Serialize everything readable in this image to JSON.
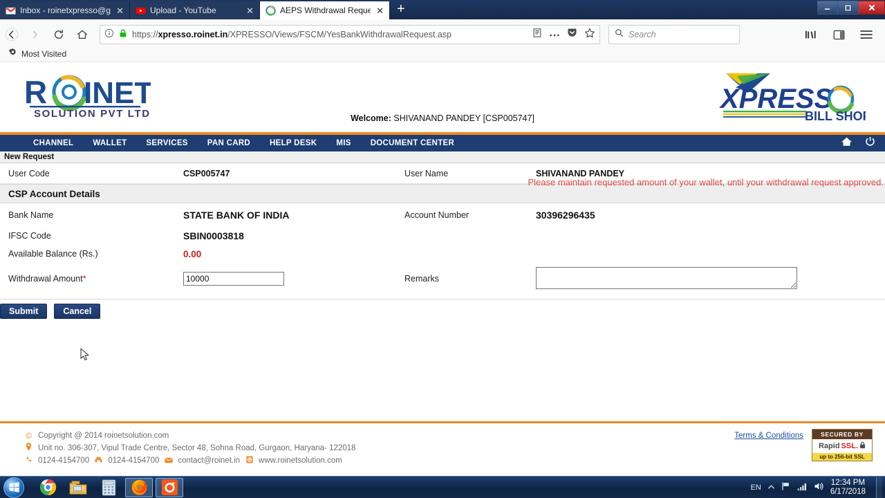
{
  "browser": {
    "tabs": [
      {
        "title": "Inbox - roinetxpresso@gmail.c",
        "favicon": "gmail-icon",
        "active": false,
        "close": "✕"
      },
      {
        "title": "Upload - YouTube",
        "favicon": "youtube-icon",
        "active": false,
        "close": "✕"
      },
      {
        "title": "AEPS Withdrawal Request",
        "favicon": "roinet-icon",
        "active": true,
        "close": "✕"
      }
    ],
    "new_tab_label": "+",
    "window_controls": {
      "minimize": "—",
      "maximize": "❐",
      "close": "✕"
    },
    "nav": {
      "back_icon": "back-arrow-icon",
      "forward_icon": "forward-arrow-icon",
      "reload_icon": "reload-icon",
      "home_icon": "home-icon",
      "info_icon": "page-info-icon",
      "lock_icon": "padlock-icon",
      "reader_icon": "reader-view-icon",
      "more_icon": "page-actions-icon",
      "pocket_icon": "pocket-icon",
      "star_icon": "bookmark-star-icon",
      "library_icon": "library-icon",
      "sidebar_icon": "sidebar-icon",
      "menu_icon": "hamburger-menu-icon"
    },
    "url": {
      "scheme": "https://",
      "host": "xpresso.roinet.in",
      "path": "/XPRESSO/Views/FSCM/YesBankWithdrawalRequest.asp",
      "truncated_tail": ""
    },
    "search": {
      "placeholder": "Search",
      "icon": "search-icon"
    },
    "bookmarks": [
      {
        "label": "Most Visited",
        "icon": "gear-icon"
      }
    ]
  },
  "site": {
    "logo_left": {
      "name": "ROINET",
      "tagline": "SOLUTION PVT LTD"
    },
    "logo_right": {
      "name": "XPRESSO",
      "tagline": "BILL SHOP"
    },
    "welcome_label": "Welcome:",
    "welcome_user": "SHIVANAND PANDEY [CSP005747]",
    "nav_items": [
      "CHANNEL",
      "WALLET",
      "SERVICES",
      "PAN CARD",
      "HELP DESK",
      "MIS",
      "DOCUMENT CENTER"
    ],
    "nav_icons": [
      "home-icon",
      "power-icon"
    ],
    "accent_orange": "#f08a24",
    "nav_blue": "#1d3d73"
  },
  "page": {
    "subbar_title": "New Request",
    "fields": {
      "user_code_label": "User Code",
      "user_code_value": "CSP005747",
      "user_name_label": "User Name",
      "user_name_value": "SHIVANAND PANDEY",
      "section_title": "CSP Account Details",
      "bank_name_label": "Bank Name",
      "bank_name_value": "STATE BANK OF INDIA",
      "account_number_label": "Account Number",
      "account_number_value": "30396296435",
      "ifsc_label": "IFSC Code",
      "ifsc_value": "SBIN0003818",
      "available_balance_label": "Available Balance (Rs.)",
      "available_balance_value": "0.00",
      "withdrawal_label": "Withdrawal Amount",
      "withdrawal_required_mark": "*",
      "withdrawal_value": "10000",
      "remarks_label": "Remarks",
      "remarks_value": ""
    },
    "buttons": {
      "submit": "Submit",
      "cancel": "Cancel"
    },
    "warning": "Please maintain requested amount of your wallet, until your withdrawal request approved.",
    "warning_color": "#e04545"
  },
  "footer": {
    "copyright": "Copyright @ 2014 roinetsolution.com",
    "copyright_icon": "copyright-icon",
    "address": "Unit no. 306-307, Vipul Trade Centre, Sector 48, Sohna Road, Gurgaon, Haryana- 122018",
    "address_icon": "location-pin-icon",
    "phone": "0124-4154700",
    "phone_icon": "phone-icon",
    "fax": "0124-4154700",
    "fax_icon": "fax-icon",
    "email": "contact@roinet.in",
    "email_icon": "envelope-icon",
    "website": "www.roinetsolution.com",
    "website_icon": "globe-icon",
    "terms_link": "Terms & Conditions",
    "ssl_badge": {
      "top": "SECURED BY",
      "brand_a": "Rapid",
      "brand_b": "SSL.",
      "bottom": "up to 256-bit SSL",
      "lock_icon": "padlock-icon"
    }
  },
  "taskbar": {
    "start_icon": "windows-start-orb",
    "items": [
      {
        "name": "chrome-icon",
        "active": false
      },
      {
        "name": "file-explorer-icon",
        "active": false
      },
      {
        "name": "calculator-icon",
        "active": false
      },
      {
        "name": "firefox-icon",
        "active": true
      },
      {
        "name": "camera-app-icon",
        "active": true
      }
    ],
    "tray": {
      "language": "EN",
      "show_hidden_icon": "chevron-up-icon",
      "flag_icon": "action-center-flag-icon",
      "network_icon": "network-signal-icon",
      "volume_icon": "volume-icon"
    },
    "clock_time": "12:34 PM",
    "clock_date": "6/17/2018"
  }
}
